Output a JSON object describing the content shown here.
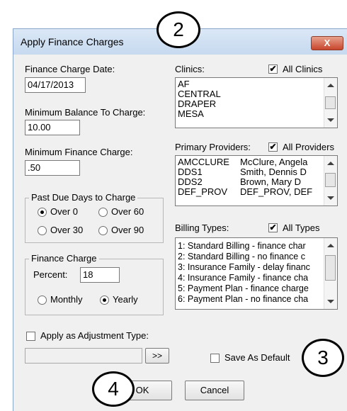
{
  "dialog": {
    "title": "Apply Finance Charges",
    "close_glyph": "X"
  },
  "finance_charge_date": {
    "label": "Finance Charge Date:",
    "value": "04/17/2013"
  },
  "min_balance": {
    "label": "Minimum Balance To Charge:",
    "value": "10.00"
  },
  "min_finance_charge": {
    "label": "Minimum Finance Charge:",
    "value": ".50"
  },
  "past_due": {
    "title": "Past Due Days to Charge",
    "options": [
      "Over 0",
      "Over 60",
      "Over 30",
      "Over 90"
    ],
    "selected": "Over 0"
  },
  "finance_charge": {
    "title": "Finance Charge",
    "percent_label": "Percent:",
    "percent_value": "18",
    "monthly_label": "Monthly",
    "yearly_label": "Yearly",
    "selected": "Yearly"
  },
  "clinics": {
    "label": "Clinics:",
    "all_label": "All Clinics",
    "all_checked": true,
    "items": [
      "AF",
      "CENTRAL",
      "DRAPER",
      "MESA"
    ]
  },
  "providers": {
    "label": "Primary Providers:",
    "all_label": "All Providers",
    "all_checked": true,
    "items": [
      {
        "abbr": "AMCCLURE",
        "name": "McClure, Angela"
      },
      {
        "abbr": "DDS1",
        "name": "Smith, Dennis D"
      },
      {
        "abbr": "DDS2",
        "name": "Brown, Mary D"
      },
      {
        "abbr": "DEF_PROV",
        "name": "DEF_PROV, DEF"
      }
    ]
  },
  "billing_types": {
    "label": "Billing Types:",
    "all_label": "All Types",
    "all_checked": true,
    "items": [
      "1: Standard Billing - finance char",
      "2: Standard Billing - no finance c",
      "3: Insurance Family - delay financ",
      "4: Insurance Family - finance cha",
      "5: Payment Plan - finance charge",
      "6: Payment Plan - no finance cha"
    ]
  },
  "adjustment": {
    "label": "Apply as Adjustment Type:",
    "checked": false,
    "value": "",
    "browse_label": ">>"
  },
  "save_default": {
    "label": "Save As Default",
    "checked": false
  },
  "buttons": {
    "ok": "OK",
    "cancel": "Cancel"
  },
  "callouts": [
    "2",
    "3",
    "4"
  ],
  "icons": {
    "check_glyph": "✔"
  }
}
